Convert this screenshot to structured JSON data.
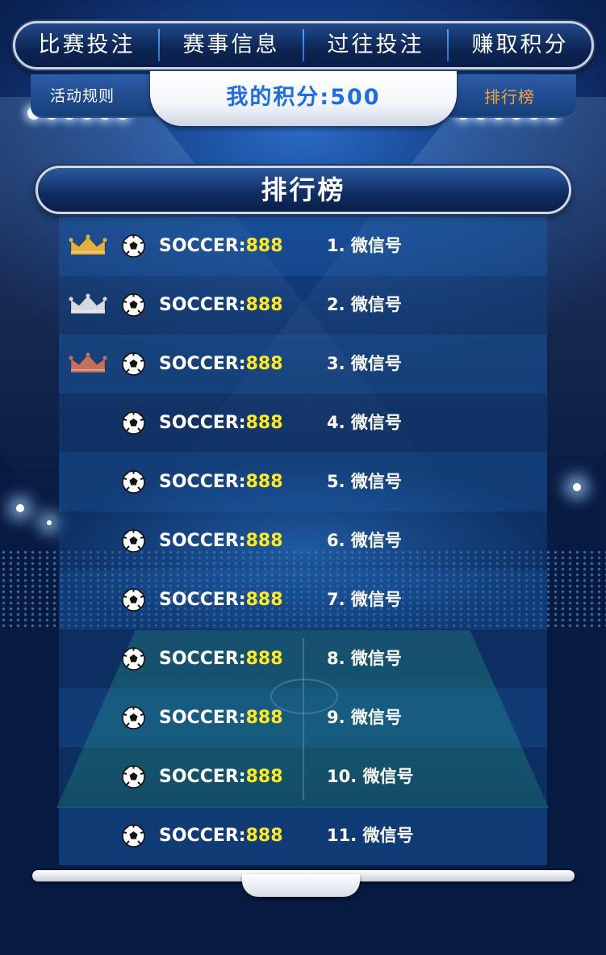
{
  "nav": {
    "tabs": [
      {
        "label": "比赛投注"
      },
      {
        "label": "赛事信息"
      },
      {
        "label": "过往投注"
      },
      {
        "label": "赚取积分"
      }
    ]
  },
  "subbar": {
    "rules_label": "活动规则",
    "points_label": "我的积分:500",
    "leaderboard_link": "排行榜"
  },
  "leaderboard": {
    "title": "排行榜",
    "rows": [
      {
        "crown": "gold-crown",
        "name_prefix": "SOCCER:",
        "score": "888",
        "rank_text": "1. 微信号"
      },
      {
        "crown": "silver-crown",
        "name_prefix": "SOCCER:",
        "score": "888",
        "rank_text": "2. 微信号"
      },
      {
        "crown": "bronze-crown",
        "name_prefix": "SOCCER:",
        "score": "888",
        "rank_text": "3. 微信号"
      },
      {
        "crown": "",
        "name_prefix": "SOCCER:",
        "score": "888",
        "rank_text": "4. 微信号"
      },
      {
        "crown": "",
        "name_prefix": "SOCCER:",
        "score": "888",
        "rank_text": "5. 微信号"
      },
      {
        "crown": "",
        "name_prefix": "SOCCER:",
        "score": "888",
        "rank_text": "6. 微信号"
      },
      {
        "crown": "",
        "name_prefix": "SOCCER:",
        "score": "888",
        "rank_text": "7. 微信号"
      },
      {
        "crown": "",
        "name_prefix": "SOCCER:",
        "score": "888",
        "rank_text": "8. 微信号"
      },
      {
        "crown": "",
        "name_prefix": "SOCCER:",
        "score": "888",
        "rank_text": "9. 微信号"
      },
      {
        "crown": "",
        "name_prefix": "SOCCER:",
        "score": "888",
        "rank_text": "10. 微信号"
      },
      {
        "crown": "",
        "name_prefix": "SOCCER:",
        "score": "888",
        "rank_text": "11. 微信号"
      }
    ]
  },
  "colors": {
    "score": "#ffe920",
    "points": "#1c6de6",
    "leaderboard_link": "#f2a23b",
    "gold": "#e3b13c",
    "silver": "#d6d9de",
    "bronze": "#c4705a"
  }
}
